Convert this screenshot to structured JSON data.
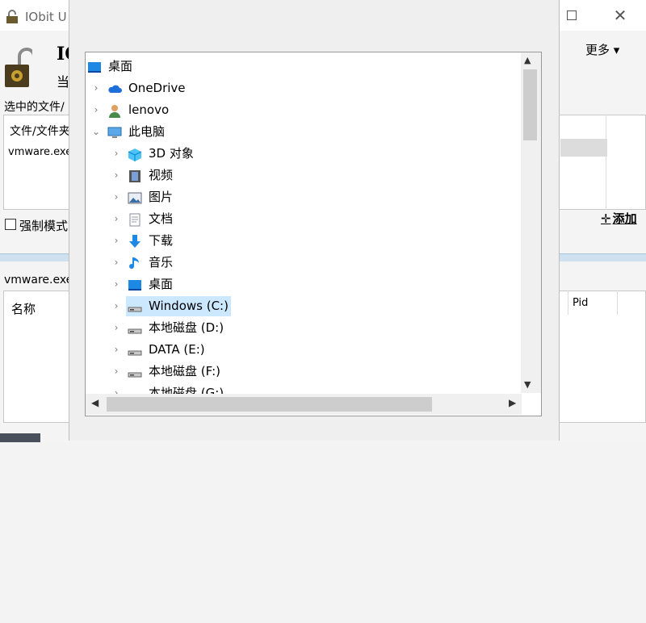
{
  "app": {
    "title": "IObit U",
    "name_partial": "IO",
    "sub_partial": "当",
    "more_menu": "更多 ▾"
  },
  "files_panel": {
    "selected_label": "选中的文件/",
    "column_header": "文件/文件夹",
    "row": "vmware.exe",
    "force_mode_label": "强制模式",
    "add_button": "添加",
    "add_symbol": "✛"
  },
  "process_panel": {
    "label": "vmware.exe",
    "col_name": "名称",
    "col_pid": "Pid"
  },
  "dialog": {
    "tree": [
      {
        "label": "桌面",
        "icon": "desktop-icon",
        "level": 0,
        "chevron": "",
        "selected": false
      },
      {
        "label": "OneDrive",
        "icon": "onedrive-cloud-icon",
        "level": 1,
        "chevron": "›",
        "selected": false
      },
      {
        "label": "lenovo",
        "icon": "user-icon",
        "level": 1,
        "chevron": "›",
        "selected": false
      },
      {
        "label": "此电脑",
        "icon": "computer-icon",
        "level": 1,
        "chevron": "⌄",
        "selected": false
      },
      {
        "label": "3D 对象",
        "icon": "3d-objects-icon",
        "level": 2,
        "chevron": "›",
        "selected": false
      },
      {
        "label": "视频",
        "icon": "video-icon",
        "level": 2,
        "chevron": "›",
        "selected": false
      },
      {
        "label": "图片",
        "icon": "pictures-icon",
        "level": 2,
        "chevron": "›",
        "selected": false
      },
      {
        "label": "文档",
        "icon": "documents-icon",
        "level": 2,
        "chevron": "›",
        "selected": false
      },
      {
        "label": "下载",
        "icon": "downloads-icon",
        "level": 2,
        "chevron": "›",
        "selected": false
      },
      {
        "label": "音乐",
        "icon": "music-icon",
        "level": 2,
        "chevron": "›",
        "selected": false
      },
      {
        "label": "桌面",
        "icon": "desktop-icon",
        "level": 2,
        "chevron": "›",
        "selected": false
      },
      {
        "label": "Windows (C:)",
        "icon": "drive-icon",
        "level": 2,
        "chevron": "›",
        "selected": true
      },
      {
        "label": "本地磁盘 (D:)",
        "icon": "drive-icon",
        "level": 2,
        "chevron": "›",
        "selected": false
      },
      {
        "label": "DATA (E:)",
        "icon": "drive-icon",
        "level": 2,
        "chevron": "›",
        "selected": false
      },
      {
        "label": "本地磁盘 (F:)",
        "icon": "drive-icon",
        "level": 2,
        "chevron": "›",
        "selected": false
      },
      {
        "label": "本地磁盘 (G:)",
        "icon": "drive-icon",
        "level": 2,
        "chevron": "›",
        "selected": false
      }
    ]
  },
  "colors": {
    "selection": "#cce8ff",
    "accent_blue": "#1e88e5",
    "divider_band": "#cfe1ee"
  }
}
